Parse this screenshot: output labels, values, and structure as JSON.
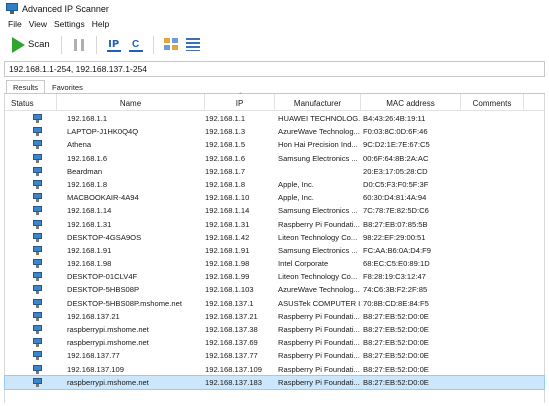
{
  "window": {
    "title": "Advanced IP Scanner"
  },
  "menu": [
    "File",
    "View",
    "Settings",
    "Help"
  ],
  "toolbar": {
    "scan_label": "Scan",
    "ip_icon_text": "IP",
    "c_icon_text": "C"
  },
  "ip_range": {
    "value": "192.168.1.1-254, 192.168.137.1-254"
  },
  "tabs": [
    "Results",
    "Favorites"
  ],
  "columns": {
    "status": "Status",
    "name": "Name",
    "ip": "IP",
    "manufacturer": "Manufacturer",
    "mac": "MAC address",
    "comments": "Comments"
  },
  "rows": [
    {
      "name": "192.168.1.1",
      "ip": "192.168.1.1",
      "manufacturer": "HUAWEI TECHNOLOG...",
      "mac": "B4:43:26:4B:19:11"
    },
    {
      "name": "LAPTOP-J1HK0Q4Q",
      "ip": "192.168.1.3",
      "manufacturer": "AzureWave Technolog...",
      "mac": "F0:03:8C:0D:6F:46"
    },
    {
      "name": "Athena",
      "ip": "192.168.1.5",
      "manufacturer": "Hon Hai Precision Ind...",
      "mac": "9C:D2:1E:7E:67:C5"
    },
    {
      "name": "192.168.1.6",
      "ip": "192.168.1.6",
      "manufacturer": "Samsung Electronics ...",
      "mac": "00:6F:64:8B:2A:AC"
    },
    {
      "name": "Beardman",
      "ip": "192.168.1.7",
      "manufacturer": "",
      "mac": "20:E3:17:05:28:CD"
    },
    {
      "name": "192.168.1.8",
      "ip": "192.168.1.8",
      "manufacturer": "Apple, Inc.",
      "mac": "D0:C5:F3:F0:5F:3F"
    },
    {
      "name": "MACBOOKAIR-4A94",
      "ip": "192.168.1.10",
      "manufacturer": "Apple, Inc.",
      "mac": "60:30:D4:81:4A:94"
    },
    {
      "name": "192.168.1.14",
      "ip": "192.168.1.14",
      "manufacturer": "Samsung Electronics ...",
      "mac": "7C:78:7E:82:5D:C6"
    },
    {
      "name": "192.168.1.31",
      "ip": "192.168.1.31",
      "manufacturer": "Raspberry Pi Foundati...",
      "mac": "B8:27:EB:07:85:5B"
    },
    {
      "name": "DESKTOP-4GSA9OS",
      "ip": "192.168.1.42",
      "manufacturer": "Liteon Technology Co...",
      "mac": "98:22:EF:29:00:51"
    },
    {
      "name": "192.168.1.91",
      "ip": "192.168.1.91",
      "manufacturer": "Samsung Electronics ...",
      "mac": "FC:AA:B6:0A:D4:F9"
    },
    {
      "name": "192.168.1.98",
      "ip": "192.168.1.98",
      "manufacturer": "Intel Corporate",
      "mac": "68:EC:C5:E0:89:1D"
    },
    {
      "name": "DESKTOP-01CLV4F",
      "ip": "192.168.1.99",
      "manufacturer": "Liteon Technology Co...",
      "mac": "F8:28:19:C3:12:47"
    },
    {
      "name": "DESKTOP-5HBS08P",
      "ip": "192.168.1.103",
      "manufacturer": "AzureWave Technolog...",
      "mac": "74:C6:3B:F2:2F:85"
    },
    {
      "name": "DESKTOP-5HBS08P.mshome.net",
      "ip": "192.168.137.1",
      "manufacturer": "ASUSTek COMPUTER I...",
      "mac": "70:8B:CD:8E:84:F5"
    },
    {
      "name": "192.168.137.21",
      "ip": "192.168.137.21",
      "manufacturer": "Raspberry Pi Foundati...",
      "mac": "B8:27:EB:52:D0:0E"
    },
    {
      "name": "raspberrypi.mshome.net",
      "ip": "192.168.137.38",
      "manufacturer": "Raspberry Pi Foundati...",
      "mac": "B8:27:EB:52:D0:0E"
    },
    {
      "name": "raspberrypi.mshome.net",
      "ip": "192.168.137.69",
      "manufacturer": "Raspberry Pi Foundati...",
      "mac": "B8:27:EB:52:D0:0E"
    },
    {
      "name": "192.168.137.77",
      "ip": "192.168.137.77",
      "manufacturer": "Raspberry Pi Foundati...",
      "mac": "B8:27:EB:52:D0:0E"
    },
    {
      "name": "192.168.137.109",
      "ip": "192.168.137.109",
      "manufacturer": "Raspberry Pi Foundati...",
      "mac": "B8:27:EB:52:D0:0E"
    },
    {
      "name": "raspberrypi.mshome.net",
      "ip": "192.168.137.183",
      "manufacturer": "Raspberry Pi Foundati...",
      "mac": "B8:27:EB:52:D0:0E",
      "selected": true
    }
  ],
  "colors": {
    "scan_green": "#2fa52f",
    "selection": "#cce6fb",
    "accent_blue": "#1f5fbf"
  }
}
